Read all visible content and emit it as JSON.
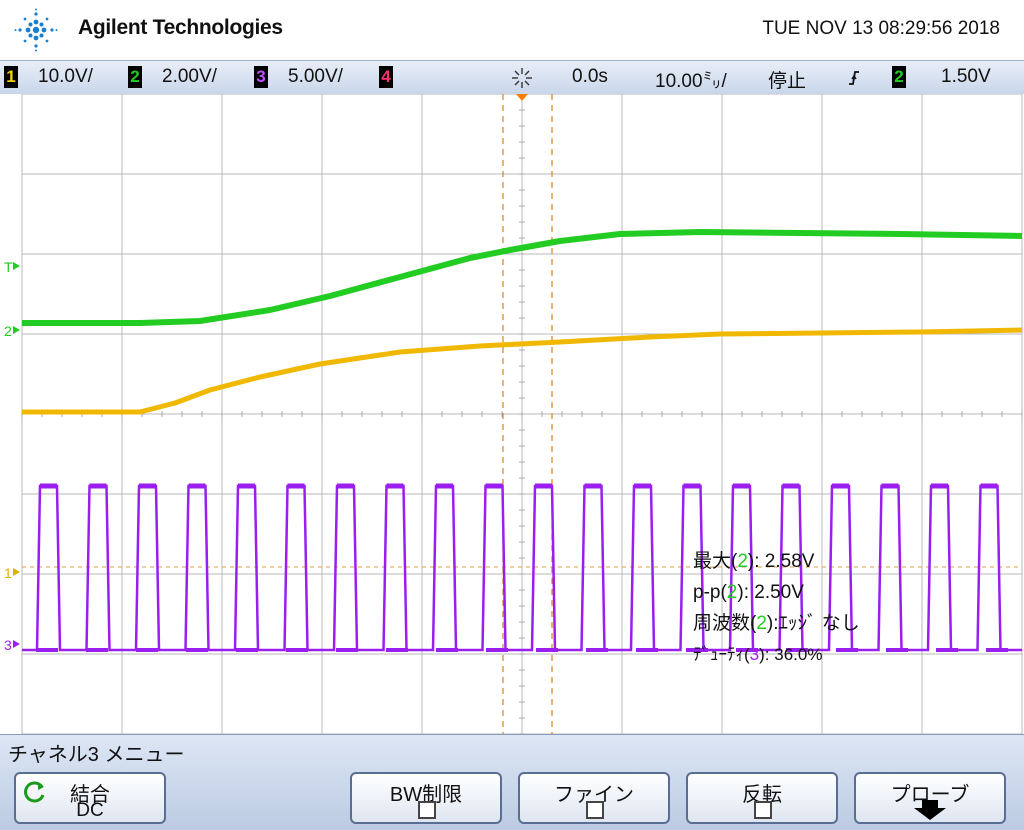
{
  "header": {
    "brand": "Agilent Technologies",
    "logo_icon": "agilent-spark-icon",
    "datetime": "TUE NOV 13 08:29:56 2018"
  },
  "status": {
    "ch1": {
      "num": "1",
      "scale": "10.0V/",
      "color": "#f0d000"
    },
    "ch2": {
      "num": "2",
      "scale": "2.00V/",
      "color": "#22cc22"
    },
    "ch3": {
      "num": "3",
      "scale": "5.00V/",
      "color": "#a020f0"
    },
    "ch4": {
      "num": "4",
      "color": "#ff3070"
    },
    "delay": "0.0s",
    "timebase": "10.00㍉/",
    "run_state": "停止",
    "trigger_slope_icon": "rising-edge-icon",
    "trigger_channel": "2",
    "trigger_level": "1.50V",
    "acq_icon": "acquisition-spark-icon"
  },
  "markers": {
    "trigger_level": "T",
    "ch2_ref": "2",
    "ch1_ref": "1",
    "ch3_ref": "3"
  },
  "measurements": {
    "max_label": "最大(",
    "max_ch": "2",
    "max_value": "): 2.58V",
    "pp_label": "p-p(",
    "pp_ch": "2",
    "pp_value": "): 2.50V",
    "freq_label": "周波数(",
    "freq_ch": "2",
    "freq_value": "):ｴｯｼﾞ なし",
    "duty_label": "ﾃﾞｭｰﾃｨ(",
    "duty_ch": "3",
    "duty_value": "): 36.0%"
  },
  "menu": {
    "title": "チャネル3 メニュー",
    "coupling_label": "結合",
    "coupling_value": "DC",
    "bw_label": "BW制限",
    "fine_label": "ファイン",
    "invert_label": "反転",
    "probe_label": "プローブ"
  },
  "waveforms": {
    "ch2_color": "#22cc22",
    "ch1_color": "#f0b800",
    "ch3_color": "#9a1ef0"
  }
}
